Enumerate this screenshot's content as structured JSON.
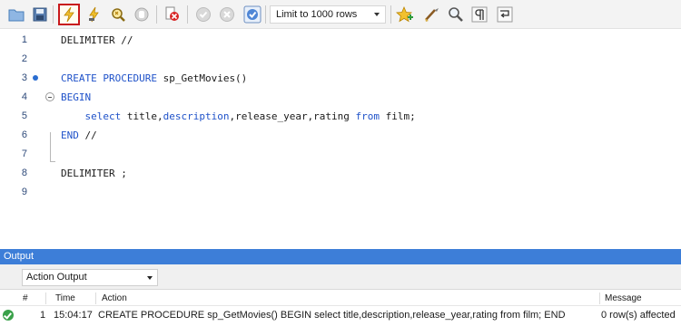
{
  "toolbar": {
    "limit_select_value": "Limit to 1000 rows",
    "buttons": [
      {
        "name": "open-folder-icon"
      },
      {
        "name": "save-icon"
      },
      {
        "name": "execute-icon"
      },
      {
        "name": "execute-current-icon"
      },
      {
        "name": "explain-icon"
      },
      {
        "name": "stop-icon"
      },
      {
        "name": "toggle-stop-on-error-icon"
      },
      {
        "name": "commit-icon"
      },
      {
        "name": "rollback-icon"
      },
      {
        "name": "autocommit-icon"
      },
      {
        "name": "add-snippet-icon"
      },
      {
        "name": "beautify-icon"
      },
      {
        "name": "find-icon"
      },
      {
        "name": "invisible-chars-icon"
      },
      {
        "name": "wrap-lines-icon"
      }
    ]
  },
  "editor": {
    "lines": [
      {
        "num": "1",
        "parts": [
          {
            "t": "DELIMITER //",
            "k": false
          }
        ]
      },
      {
        "num": "2",
        "parts": []
      },
      {
        "num": "3",
        "parts": [
          {
            "t": "CREATE PROCEDURE",
            "k": true
          },
          {
            "t": " sp_GetMovies()",
            "k": false
          }
        ]
      },
      {
        "num": "4",
        "parts": [
          {
            "t": "BEGIN",
            "k": true
          }
        ]
      },
      {
        "num": "5",
        "parts": [
          {
            "t": "    ",
            "k": false
          },
          {
            "t": "select",
            "k": true
          },
          {
            "t": " title,",
            "k": false
          },
          {
            "t": "description",
            "k": true
          },
          {
            "t": ",release_year,rating ",
            "k": false
          },
          {
            "t": "from",
            "k": true
          },
          {
            "t": " film;",
            "k": false
          }
        ]
      },
      {
        "num": "6",
        "parts": [
          {
            "t": "END",
            "k": true
          },
          {
            "t": " //",
            "k": false
          }
        ]
      },
      {
        "num": "7",
        "parts": []
      },
      {
        "num": "8",
        "parts": [
          {
            "t": "DELIMITER ;",
            "k": false
          }
        ]
      },
      {
        "num": "9",
        "parts": []
      }
    ]
  },
  "output": {
    "header_title": "Output",
    "type_select_value": "Action Output",
    "columns": {
      "num": "#",
      "time": "Time",
      "action": "Action",
      "message": "Message"
    },
    "rows": [
      {
        "num": "1",
        "time": "15:04:17",
        "action": "CREATE PROCEDURE sp_GetMovies() BEGIN select title,description,release_year,rating from film; END",
        "message": "0 row(s) affected",
        "status": "success"
      }
    ]
  },
  "colors": {
    "keyword": "#1f52c9",
    "output_header": "#3d7ed8",
    "highlight_border": "#c8191c",
    "success": "#3aa14a"
  }
}
